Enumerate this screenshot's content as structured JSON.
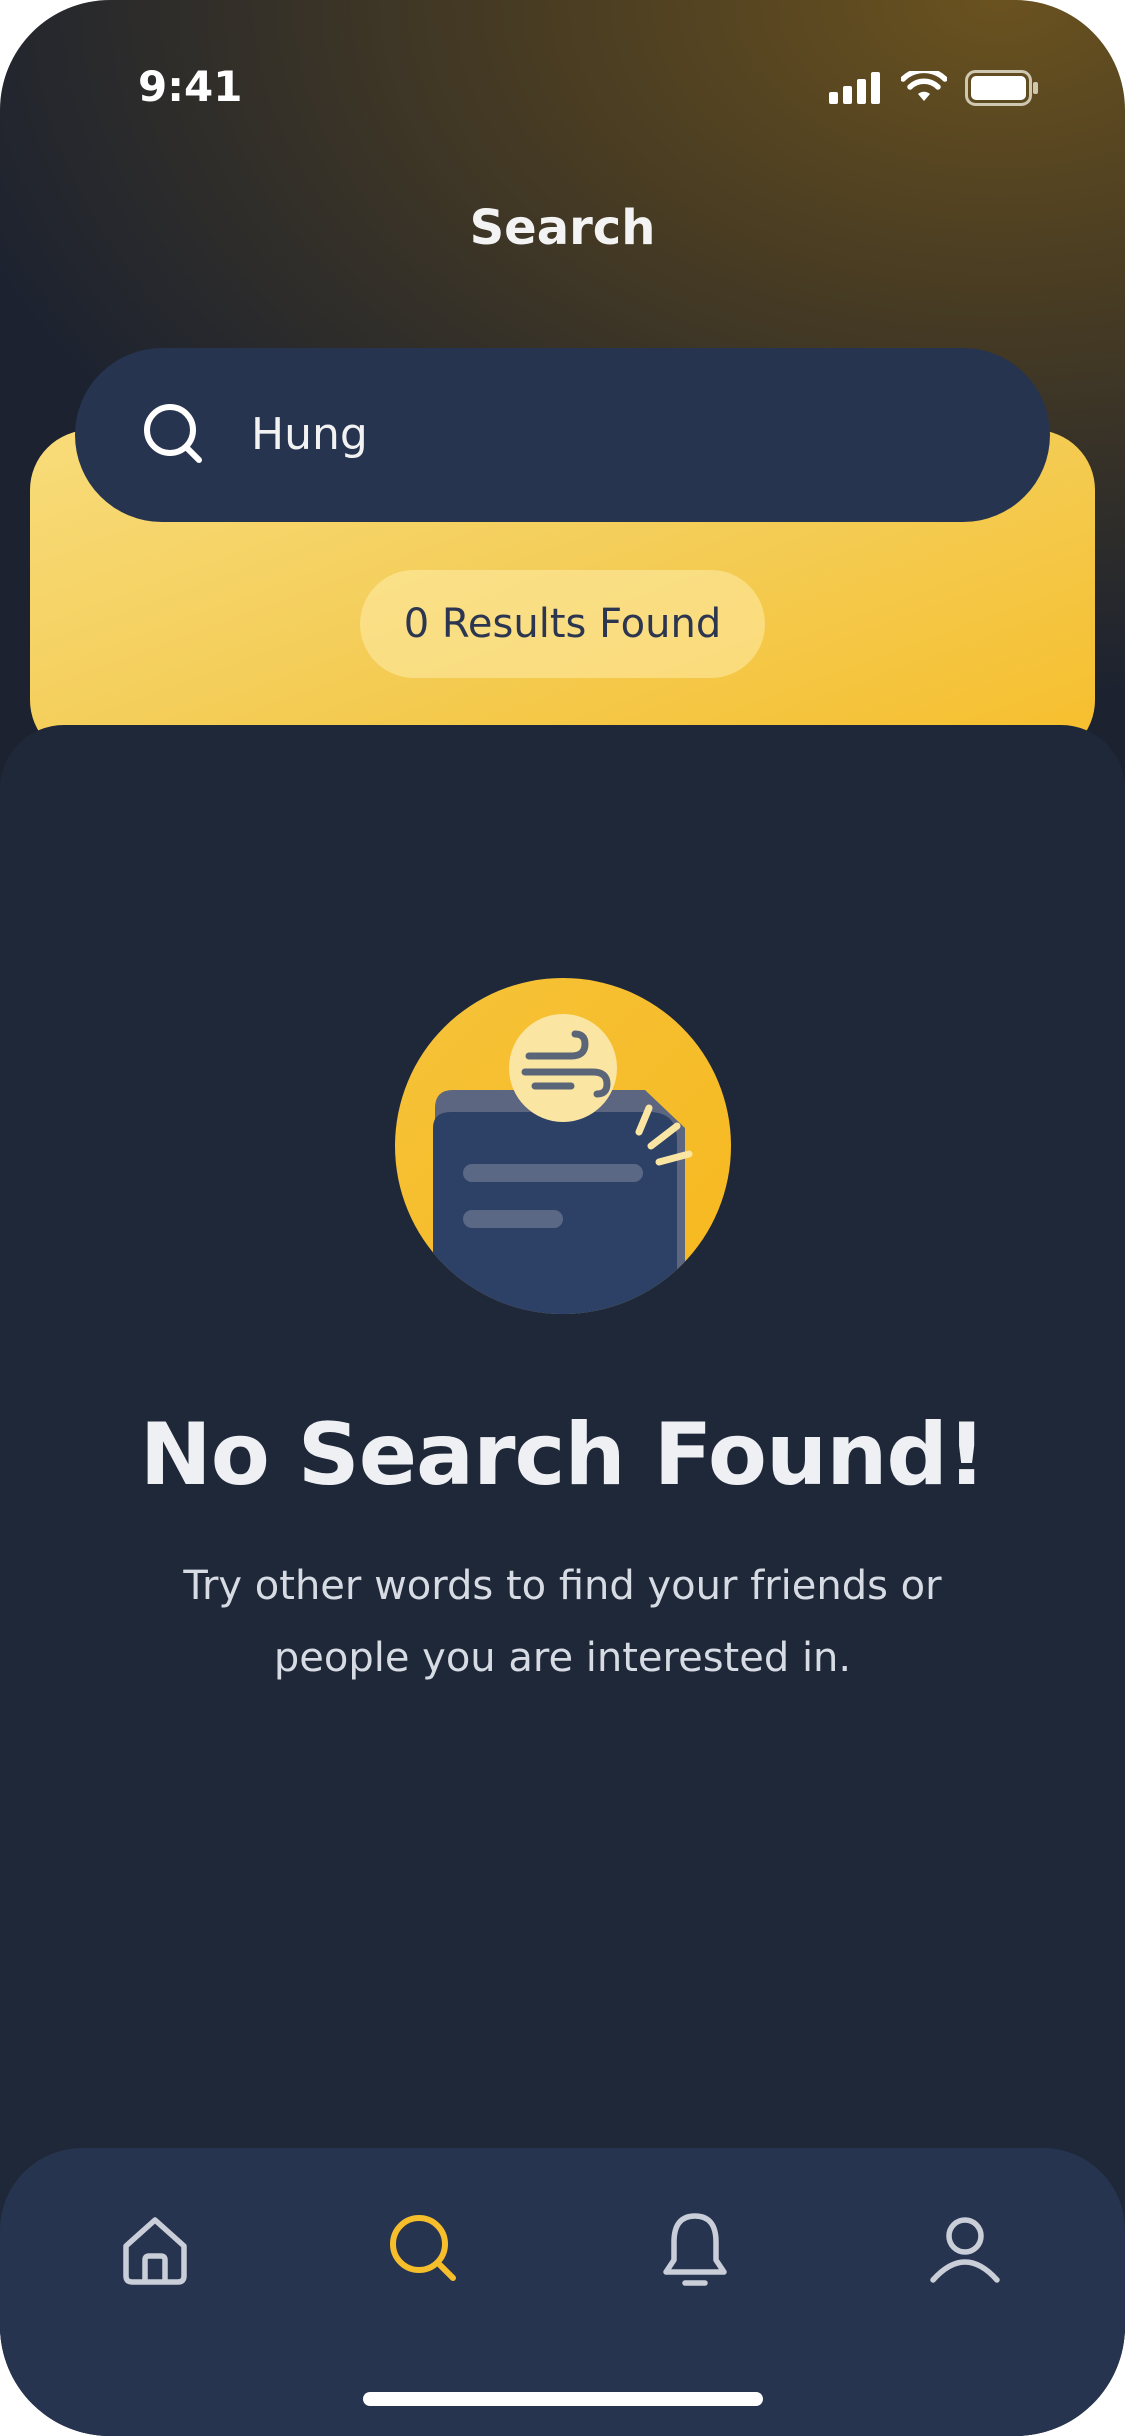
{
  "status_bar": {
    "time": "9:41",
    "icons": [
      "signal-icon",
      "wifi-icon",
      "battery-icon"
    ]
  },
  "header": {
    "title": "Search"
  },
  "search": {
    "value": "Hung",
    "icon": "search-icon"
  },
  "results": {
    "label": "0 Results Found"
  },
  "empty_state": {
    "illustration": "empty-folder-illustration",
    "title": "No Search Found!",
    "description": "Try other words to find your friends or people you are interested in."
  },
  "bottom_nav": {
    "items": [
      {
        "name": "home",
        "icon": "home-icon",
        "active": false
      },
      {
        "name": "search",
        "icon": "search-icon",
        "active": true
      },
      {
        "name": "notifications",
        "icon": "bell-icon",
        "active": false
      },
      {
        "name": "profile",
        "icon": "user-icon",
        "active": false
      }
    ]
  },
  "colors": {
    "accent": "#F6BE2B",
    "surface": "#1F2839",
    "nav_background": "#263450",
    "icon_inactive": "#C9CED8"
  }
}
